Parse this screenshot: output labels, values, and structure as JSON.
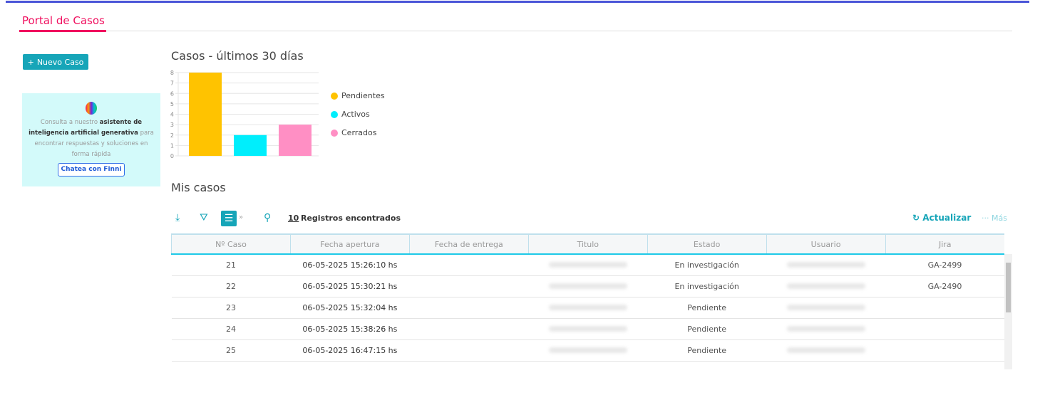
{
  "header": {
    "tab": "Portal de Casos"
  },
  "sidebar": {
    "new_case": "Nuevo Caso",
    "assistant": {
      "pre": "Consulta a nuestro ",
      "bold": "asistente de inteligencia artificial generativa",
      "post": " para encontrar respuestas y soluciones en forma rápida",
      "button": "Chatea con Finni"
    }
  },
  "chart_data": {
    "type": "bar",
    "title": "Casos - últimos 30 días",
    "categories": [
      "Pendientes",
      "Activos",
      "Cerrados"
    ],
    "values": [
      8,
      2,
      3
    ],
    "colors": [
      "#ffc300",
      "#00eefc",
      "#ff8fc4"
    ],
    "ylim": [
      0,
      8
    ],
    "yticks": [
      "0",
      "1",
      "2",
      "3",
      "4",
      "5",
      "6",
      "7",
      "8"
    ],
    "legend": "right",
    "grid": true
  },
  "mis_casos": {
    "title": "Mis casos",
    "count": "10",
    "count_label": "Registros encontrados",
    "refresh": "Actualizar",
    "more": "··· Más",
    "columns": [
      "Nº Caso",
      "Fecha apertura",
      "Fecha de entrega",
      "Titulo",
      "Estado",
      "Usuario",
      "Jira"
    ],
    "rows": [
      {
        "id": "21",
        "fecha": "06-05-2025 15:26:10 hs",
        "estado": "En investigación",
        "jira": "GA-2499"
      },
      {
        "id": "22",
        "fecha": "06-05-2025 15:30:21 hs",
        "estado": "En investigación",
        "jira": "GA-2490"
      },
      {
        "id": "23",
        "fecha": "06-05-2025 15:32:04 hs",
        "estado": "Pendiente",
        "jira": ""
      },
      {
        "id": "24",
        "fecha": "06-05-2025 15:38:26 hs",
        "estado": "Pendiente",
        "jira": ""
      },
      {
        "id": "25",
        "fecha": "06-05-2025 16:47:15 hs",
        "estado": "Pendiente",
        "jira": ""
      }
    ]
  }
}
